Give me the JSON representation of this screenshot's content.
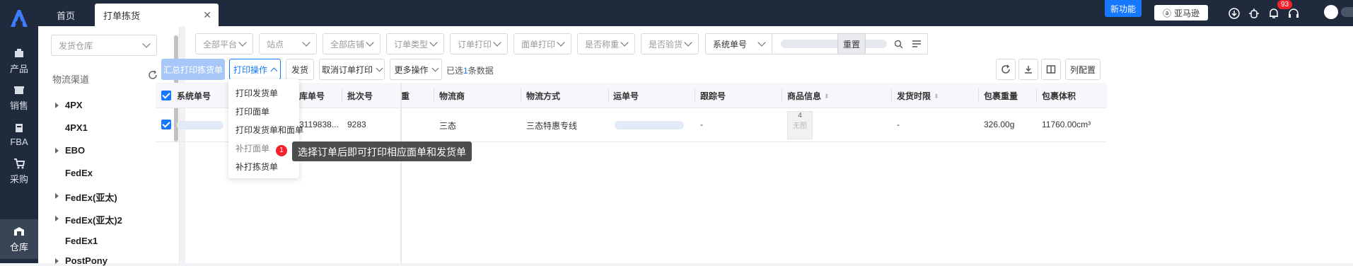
{
  "nav": {
    "items": [
      {
        "label": "产品",
        "icon": "box-icon"
      },
      {
        "label": "销售",
        "icon": "store-icon"
      },
      {
        "label": "FBA",
        "icon": "fba-icon"
      },
      {
        "label": "采购",
        "icon": "cart-icon"
      },
      {
        "label": "仓库",
        "icon": "warehouse-icon"
      }
    ],
    "active": "仓库"
  },
  "tabs": {
    "home": "首页",
    "current": "打单拣货"
  },
  "topbar": {
    "new_feature": "新功能",
    "amazon": "亚马逊",
    "badge_count": "93"
  },
  "sidebar": {
    "warehouse_placeholder": "发货仓库",
    "channel_title": "物流渠道",
    "channels": [
      {
        "label": "4PX",
        "expandable": true
      },
      {
        "label": "4PX1",
        "expandable": false
      },
      {
        "label": "EBO",
        "expandable": true
      },
      {
        "label": "FedEx",
        "expandable": false
      },
      {
        "label": "FedEx(亚太)",
        "expandable": true
      },
      {
        "label": "FedEx(亚太)2",
        "expandable": true
      },
      {
        "label": "FedEx1",
        "expandable": false
      },
      {
        "label": "PostPony",
        "expandable": true
      }
    ]
  },
  "filters": {
    "platform": "全部平台",
    "site": "站点",
    "store": "全部店铺",
    "order_type": "订单类型",
    "order_print": "订单打印",
    "label_print": "面单打印",
    "weighed": "是否称重",
    "inspected": "是否验货",
    "search_field": "系统单号",
    "reset": "重置"
  },
  "actions": {
    "summary_print": "汇总打印拣货单",
    "print_ops": "打印操作",
    "ship": "发货",
    "cancel_print": "取消订单打印",
    "more": "更多操作",
    "selected_prefix": "已选",
    "selected_count": "1",
    "selected_suffix": "条数据",
    "column_config": "列配置"
  },
  "print_menu": [
    "打印发货单",
    "打印面单",
    "打印发货单和面单",
    "补打面单",
    "补打拣货单"
  ],
  "tooltip": {
    "step": "1",
    "text": "选择订单后即可打印相应面单和发货单"
  },
  "table": {
    "headers": {
      "system_no": "系统单号",
      "warehouse_no": "库单号",
      "batch_no": "批次号",
      "weight": "重",
      "carrier": "物流商",
      "method": "物流方式",
      "tracking": "运单号",
      "track_id": "跟踪号",
      "product": "商品信息",
      "ship_limit": "发货时限",
      "pkg_weight": "包裹重量",
      "pkg_volume": "包裹体积"
    },
    "rows": [
      {
        "warehouse_no": "3119838...",
        "batch_no": "9283",
        "carrier": "三态",
        "method": "三态特惠专线",
        "track_id": "-",
        "product_qty": "4",
        "product_img": "无图",
        "ship_limit": "-",
        "pkg_weight": "326.00g",
        "pkg_volume": "11760.00cm³"
      }
    ]
  }
}
